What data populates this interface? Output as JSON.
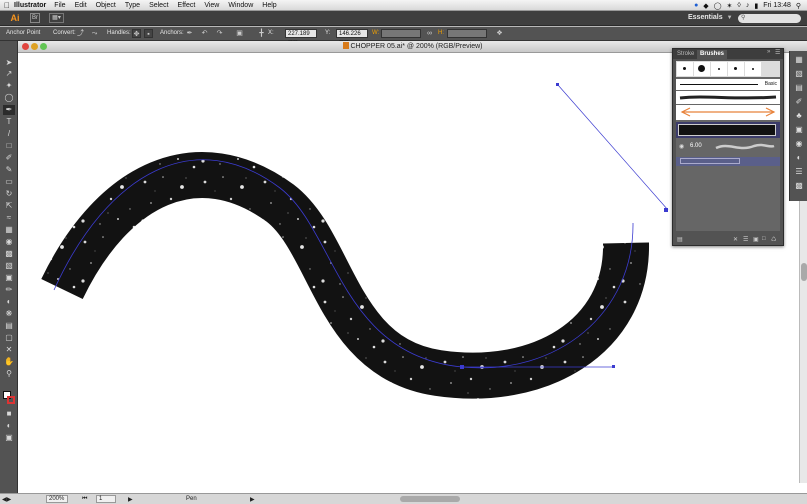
{
  "menubar": {
    "app_name": "Illustrator",
    "items": [
      "File",
      "Edit",
      "Object",
      "Type",
      "Select",
      "Effect",
      "View",
      "Window",
      "Help"
    ],
    "clock": "Fri 13:48"
  },
  "appbar": {
    "logo": "Ai",
    "bridge": "Br",
    "workspace": "Essentials"
  },
  "control": {
    "tool_label": "Anchor Point",
    "convert_label": "Convert:",
    "handles_label": "Handles:",
    "anchors_label": "Anchors:",
    "x_label": "X:",
    "x_value": "227.189 mm",
    "y_label": "Y:",
    "y_value": "146.226 mm",
    "w_label": "W:",
    "h_label": "H:"
  },
  "document": {
    "title": "CHOPPER 05.ai* @ 200% (RGB/Preview)"
  },
  "brushes_panel": {
    "tab_stroke": "Stroke",
    "tab_brushes": "Brushes",
    "basic_label": "Basic",
    "size_value": "6.00"
  },
  "status": {
    "zoom": "200%",
    "page": "1",
    "tool": "Pen"
  },
  "colors": {
    "canvas": "#ffffff",
    "ui_panel": "#535353",
    "path_guide": "#3b3bd0",
    "arrow_orange": "#e8823a"
  }
}
